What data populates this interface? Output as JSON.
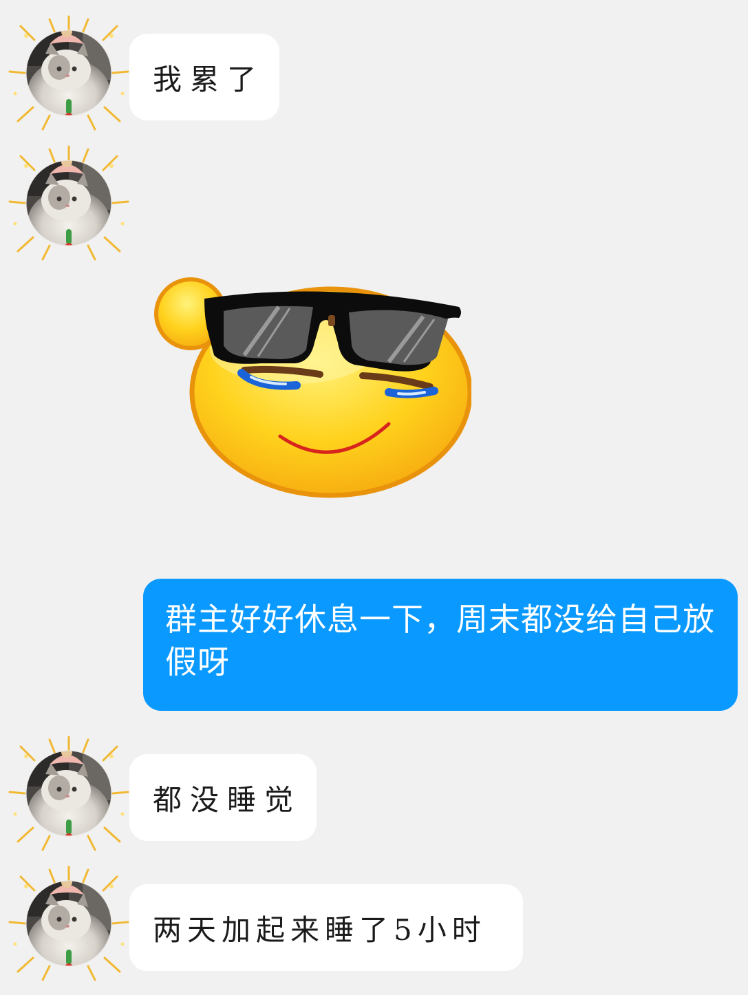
{
  "messages": [
    {
      "sender": "other",
      "type": "text",
      "text": "我累了"
    },
    {
      "sender": "other",
      "type": "sticker",
      "sticker": "sunglasses-smiley-sticker"
    },
    {
      "sender": "me",
      "type": "text",
      "text": "群主好好休息一下，周末都没给自己放假呀"
    },
    {
      "sender": "other",
      "type": "text",
      "text": "都没睡觉"
    },
    {
      "sender": "other",
      "type": "text",
      "text": "两天加起来睡了5小时"
    }
  ],
  "colors": {
    "background": "#f1f1f1",
    "incoming_bubble": "#ffffff",
    "outgoing_bubble": "#0a99ff",
    "outgoing_text": "#ffffff",
    "incoming_text": "#1b1b1b"
  },
  "icons": {
    "avatar": "cat-avatar-with-sparkle-frame",
    "sticker": "sunglasses-smiley-sticker"
  }
}
